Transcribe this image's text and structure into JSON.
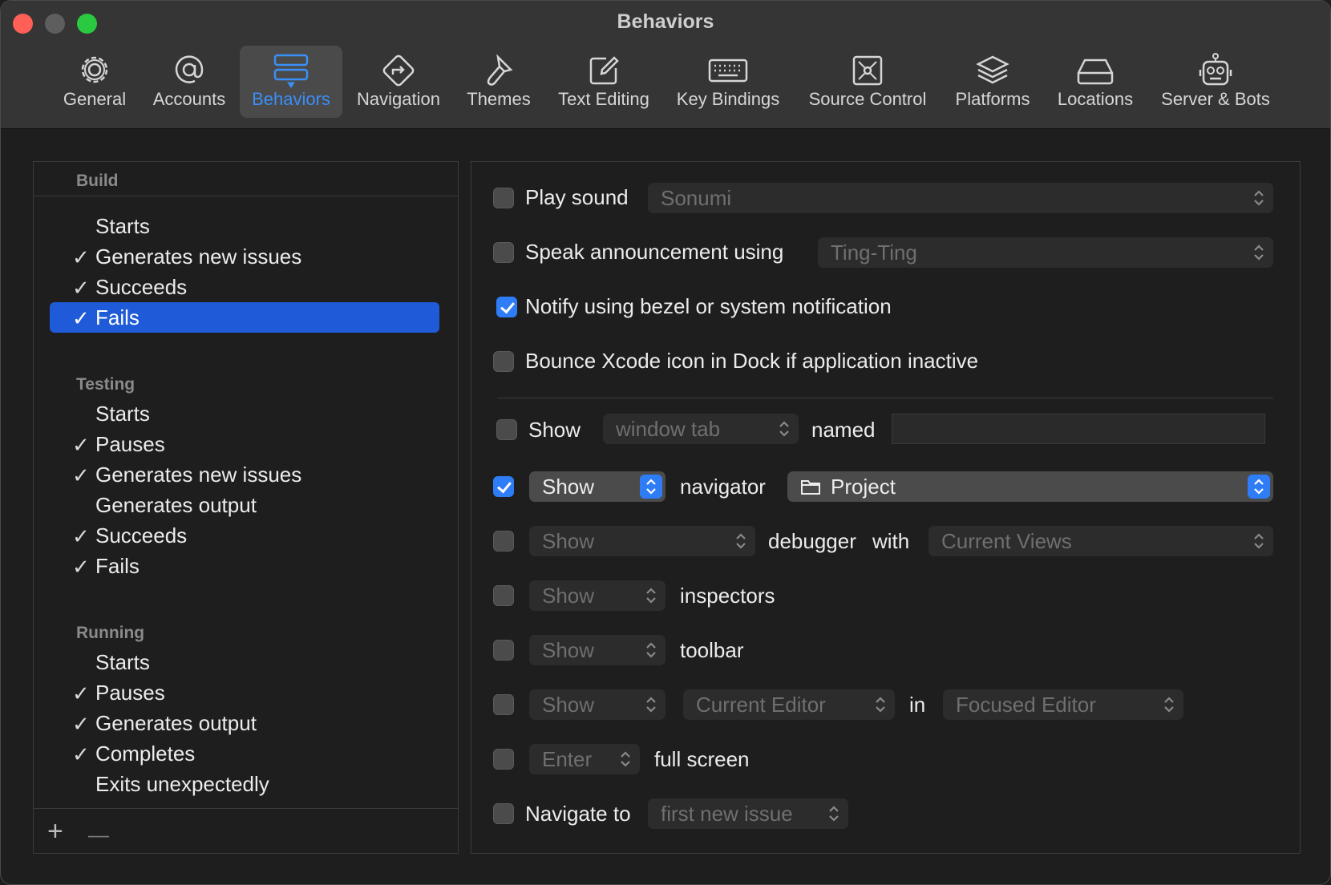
{
  "window": {
    "title": "Behaviors"
  },
  "toolbar": {
    "tabs": [
      {
        "label": "General",
        "icon": "gear-icon"
      },
      {
        "label": "Accounts",
        "icon": "at-icon"
      },
      {
        "label": "Behaviors",
        "icon": "behaviors-icon",
        "active": true
      },
      {
        "label": "Navigation",
        "icon": "navigation-icon"
      },
      {
        "label": "Themes",
        "icon": "brush-icon"
      },
      {
        "label": "Text Editing",
        "icon": "pencil-square-icon"
      },
      {
        "label": "Key Bindings",
        "icon": "keyboard-icon"
      },
      {
        "label": "Source Control",
        "icon": "source-control-icon"
      },
      {
        "label": "Platforms",
        "icon": "stack-icon"
      },
      {
        "label": "Locations",
        "icon": "drive-icon"
      },
      {
        "label": "Server & Bots",
        "icon": "robot-icon"
      }
    ],
    "accent_color": "#3a8ff8"
  },
  "sidebar": {
    "groups": [
      {
        "header": "Build",
        "items": [
          {
            "label": "Starts",
            "checked": false
          },
          {
            "label": "Generates new issues",
            "checked": true
          },
          {
            "label": "Succeeds",
            "checked": true
          },
          {
            "label": "Fails",
            "checked": true,
            "selected": true
          }
        ]
      },
      {
        "header": "Testing",
        "items": [
          {
            "label": "Starts",
            "checked": false
          },
          {
            "label": "Pauses",
            "checked": true
          },
          {
            "label": "Generates new issues",
            "checked": true
          },
          {
            "label": "Generates output",
            "checked": false
          },
          {
            "label": "Succeeds",
            "checked": true
          },
          {
            "label": "Fails",
            "checked": true
          }
        ]
      },
      {
        "header": "Running",
        "items": [
          {
            "label": "Starts",
            "checked": false
          },
          {
            "label": "Pauses",
            "checked": true
          },
          {
            "label": "Generates output",
            "checked": true
          },
          {
            "label": "Completes",
            "checked": true
          },
          {
            "label": "Exits unexpectedly",
            "checked": false
          }
        ]
      }
    ],
    "check_glyph": "✓",
    "add_label": "+",
    "remove_label": "—",
    "selection_color": "#1f5bd8"
  },
  "settings": {
    "play_sound": {
      "label": "Play sound",
      "checked": false,
      "value": "Sonumi"
    },
    "speak": {
      "label": "Speak announcement using",
      "checked": false,
      "value": "Ting-Ting"
    },
    "notify": {
      "label": "Notify using bezel or system notification",
      "checked": true
    },
    "bounce": {
      "label": "Bounce Xcode icon in Dock if application inactive",
      "checked": false
    },
    "show_tab": {
      "label": "Show",
      "checked": false,
      "value": "window tab",
      "named_label": "named",
      "name_value": ""
    },
    "navigator": {
      "checked": true,
      "show_value": "Show",
      "label": "navigator",
      "value": "Project"
    },
    "debugger": {
      "checked": false,
      "show_value": "Show",
      "label": "debugger",
      "with_label": "with",
      "value": "Current Views"
    },
    "inspectors": {
      "checked": false,
      "show_value": "Show",
      "label": "inspectors"
    },
    "toolbar_row": {
      "checked": false,
      "show_value": "Show",
      "label": "toolbar"
    },
    "editor": {
      "checked": false,
      "show_value": "Show",
      "editor_value": "Current Editor",
      "in_label": "in",
      "target_value": "Focused Editor"
    },
    "full_screen": {
      "checked": false,
      "value": "Enter",
      "label": "full screen"
    },
    "navigate_to": {
      "label": "Navigate to",
      "checked": false,
      "value": "first new issue"
    }
  },
  "colors": {
    "checkbox_on": "#2e7df6"
  }
}
